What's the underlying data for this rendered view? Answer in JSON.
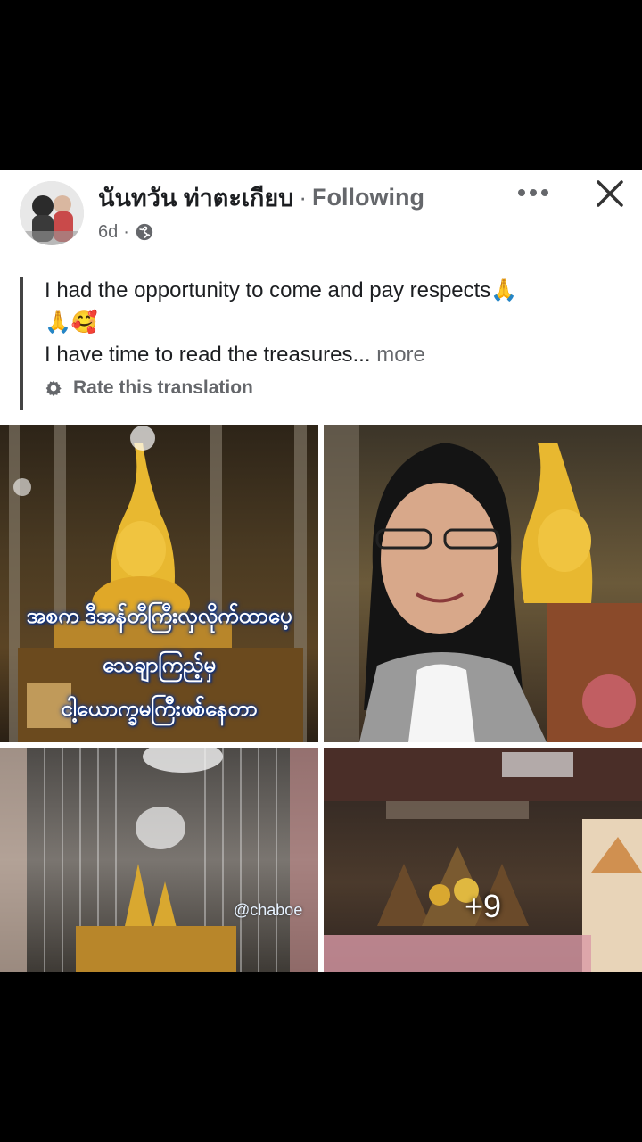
{
  "post": {
    "author": "นันทวัน ท่าตะเกียบ",
    "separator": "·",
    "follow_status": "Following",
    "time": "6d",
    "meta_separator": "·",
    "privacy_icon": "globe-icon",
    "text_line1": "I had the opportunity to come and pay respects🙏",
    "text_line2": "🙏🥰",
    "text_line3_main": "I have time to read the treasures...",
    "text_more": "more",
    "rate_translation": "Rate this translation"
  },
  "icons": {
    "more": "more-horizontal-icon",
    "close": "close-icon",
    "gear": "gear-icon"
  },
  "photos": {
    "overlay_line1": "အစက ဒီအန်တီကြီးလှလိုက်ထာပေ့",
    "overlay_line2": "သေချာကြည့်မှ",
    "overlay_line3": "ငါ့ယောက္ခမကြီးဖစ်နေတာ",
    "watermark": "@chaboe",
    "more_count": "+9"
  },
  "colors": {
    "text_primary": "#1c1e21",
    "text_secondary": "#65676b",
    "overlay_glow": "#0a3aa0"
  }
}
